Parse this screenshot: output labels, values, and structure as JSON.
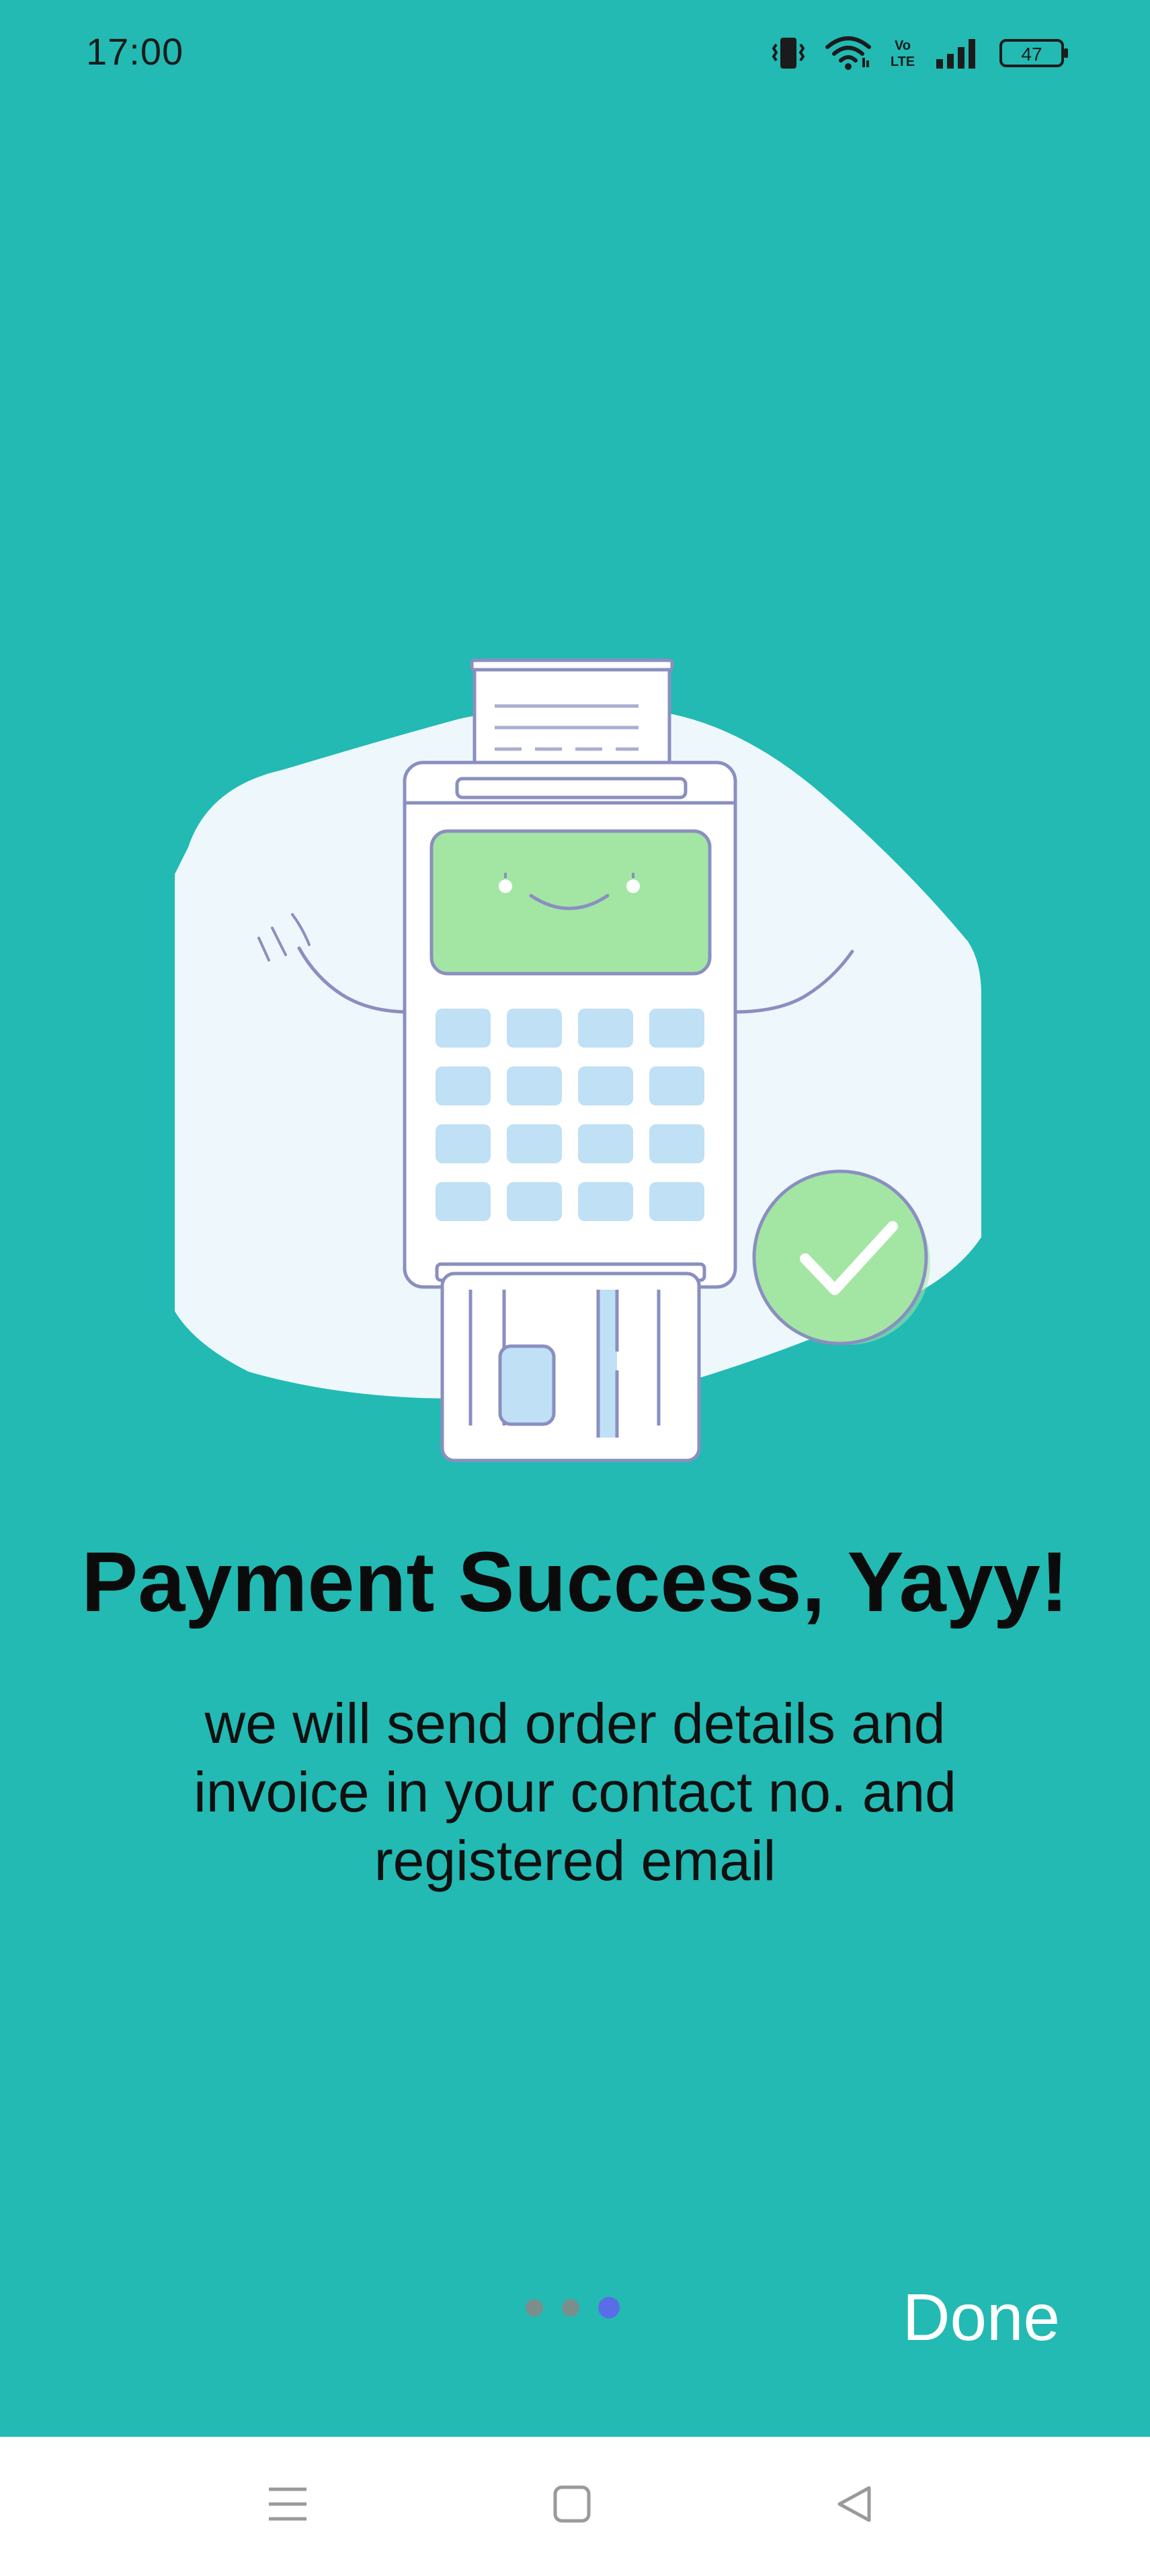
{
  "status_bar": {
    "time": "17:00",
    "battery_level": "47",
    "icons": [
      "vibrate-icon",
      "wifi-icon",
      "volte-icon",
      "signal-icon",
      "battery-icon"
    ],
    "volte_text": "Vo LTE"
  },
  "content": {
    "title": "Payment Success, Yayy!",
    "subtitle": "we will send order details and invoice in your contact no. and registered email",
    "illustration": "payment-terminal-success-illustration"
  },
  "pager": {
    "total_pages": 3,
    "current_page": 3
  },
  "actions": {
    "done_label": "Done"
  },
  "nav_bar": {
    "icons": [
      "menu-icon",
      "home-icon",
      "back-icon"
    ]
  },
  "colors": {
    "background": "#22bab3",
    "active_dot": "#5b6de6",
    "inactive_dot": "#7a8e8c",
    "screen_green": "#a3e6a4",
    "key_blue": "#bfe0f5",
    "outline": "#8a8fc0",
    "blob": "#eef8fc"
  }
}
